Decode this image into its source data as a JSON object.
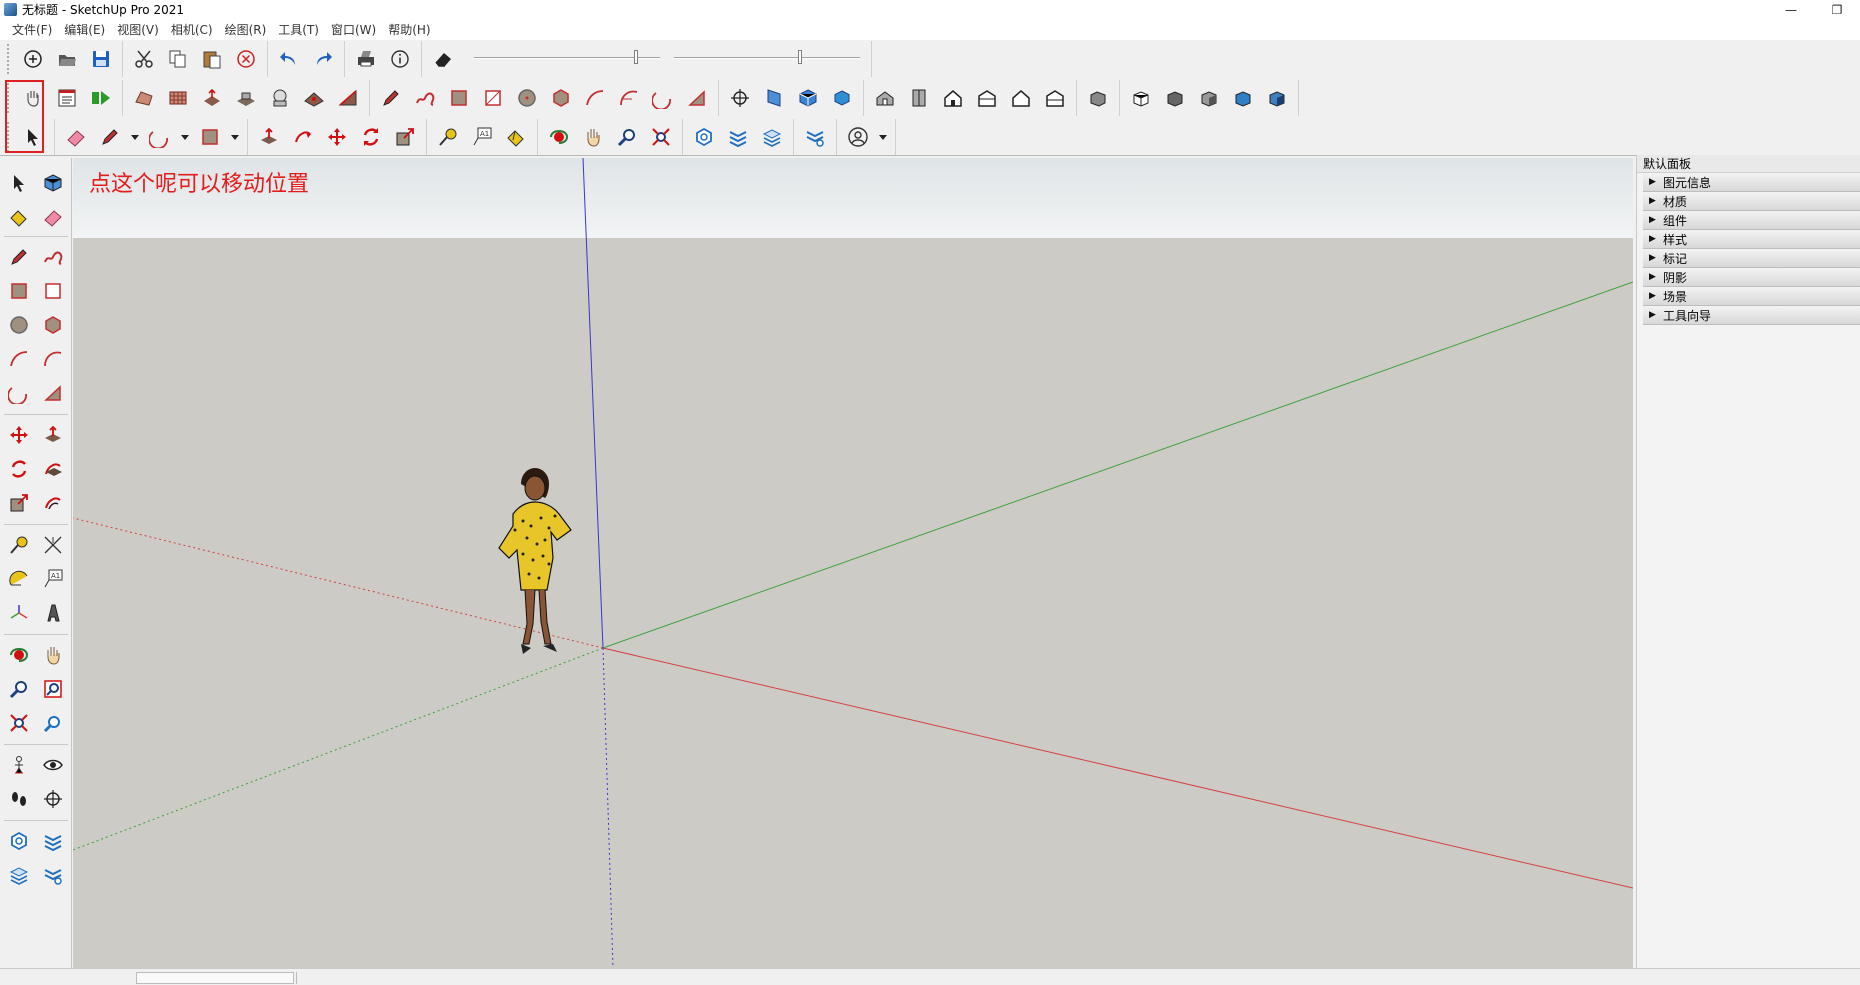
{
  "window": {
    "title": "无标题 - SketchUp Pro 2021",
    "minimize_label": "—",
    "maximize_label": "❐"
  },
  "menu": {
    "items": [
      {
        "label": "文件(F)"
      },
      {
        "label": "编辑(E)"
      },
      {
        "label": "视图(V)"
      },
      {
        "label": "相机(C)"
      },
      {
        "label": "绘图(R)"
      },
      {
        "label": "工具(T)"
      },
      {
        "label": "窗口(W)"
      },
      {
        "label": "帮助(H)"
      }
    ]
  },
  "canvas": {
    "annotation": "点这个呢可以移动位置"
  },
  "tray": {
    "title": "默认面板",
    "items": [
      {
        "label": "图元信息"
      },
      {
        "label": "材质"
      },
      {
        "label": "组件"
      },
      {
        "label": "样式"
      },
      {
        "label": "标记"
      },
      {
        "label": "阴影"
      },
      {
        "label": "场景"
      },
      {
        "label": "工具向导"
      }
    ]
  },
  "colors": {
    "axis_red": "#d64040",
    "axis_green": "#3aa23a",
    "axis_blue": "#3838c8",
    "annotation_red": "#e51c1c",
    "ground": "#cccbc6"
  }
}
